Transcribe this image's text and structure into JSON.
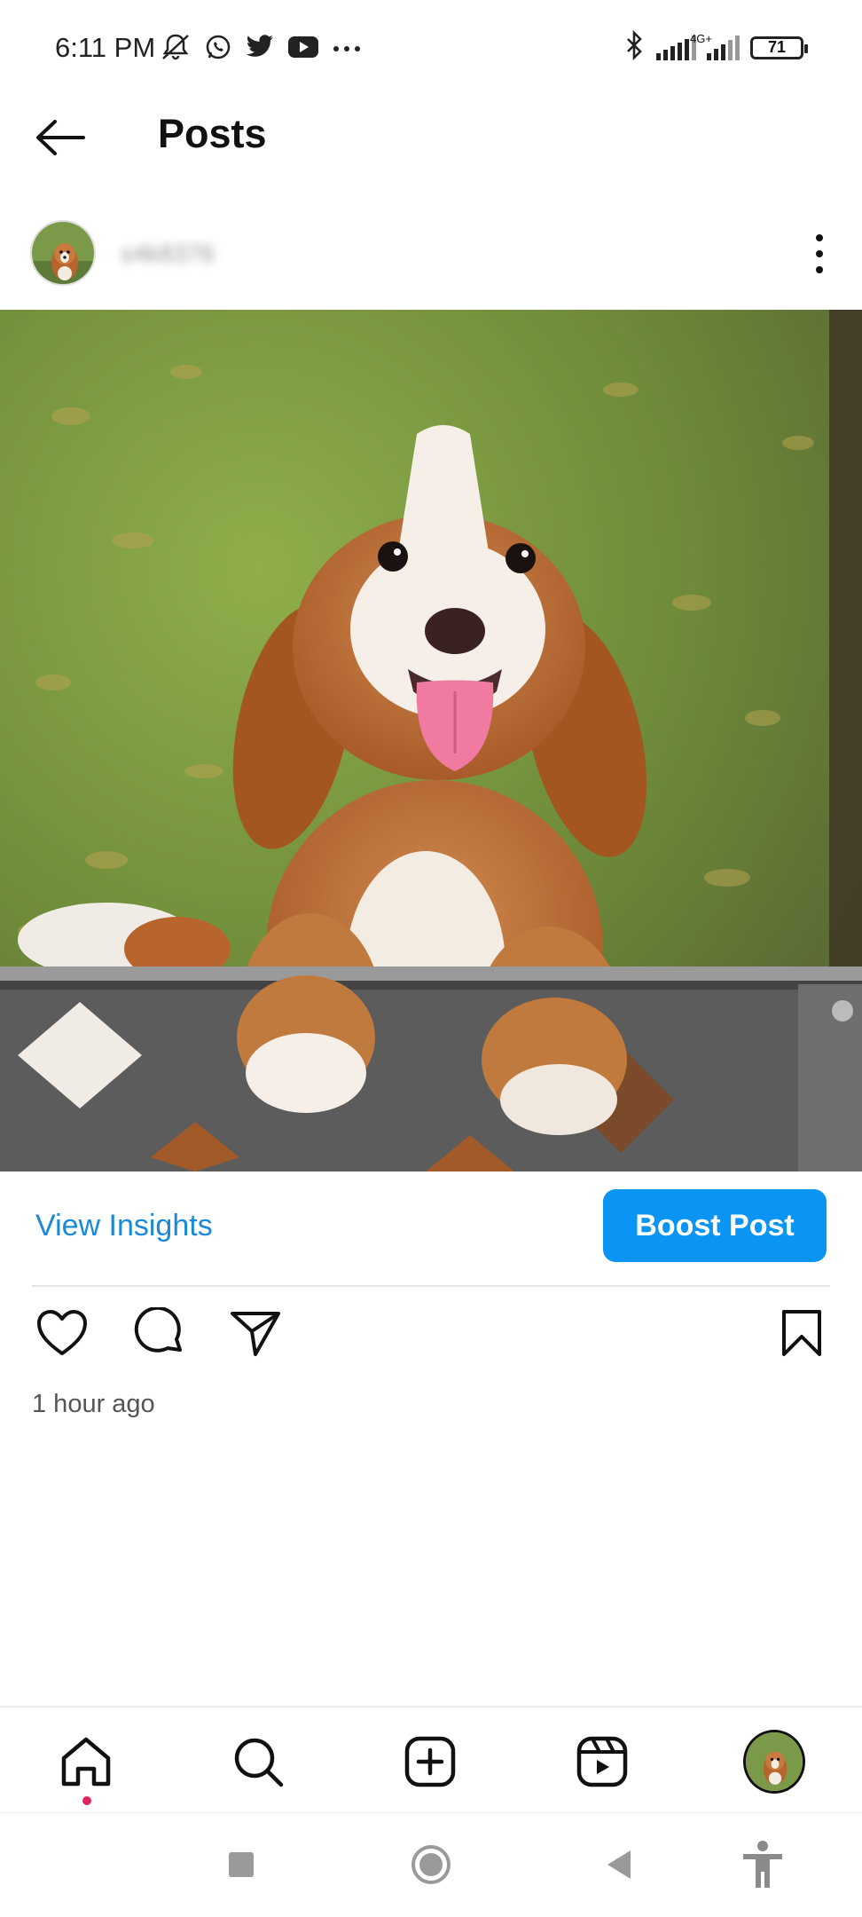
{
  "status_bar": {
    "time": "6:11 PM",
    "network_label": "4G+",
    "battery": "71",
    "icons": [
      "mute-icon",
      "whatsapp-icon",
      "twitter-icon",
      "youtube-icon",
      "more-icon",
      "bluetooth-icon",
      "signal-icon",
      "signal-icon"
    ]
  },
  "header": {
    "title": "Posts",
    "back_icon": "arrow-left-icon"
  },
  "post": {
    "username": "s4k8376",
    "avatar": "dog-avatar",
    "image": "puppy-photo",
    "timestamp": "1 hour ago"
  },
  "insights": {
    "view_label": "View Insights",
    "boost_label": "Boost Post"
  },
  "actions": [
    "heart-icon",
    "comment-icon",
    "share-icon",
    "bookmark-icon"
  ],
  "bottom_nav": {
    "items": [
      "home-icon",
      "search-icon",
      "create-icon",
      "reels-icon",
      "profile-avatar"
    ],
    "active": "home-icon"
  },
  "system_nav": [
    "recents-icon",
    "home-circle-icon",
    "back-triangle-icon",
    "accessibility-icon"
  ],
  "colors": {
    "accent_blue": "#0a95f5",
    "link_blue": "#1a8ad8",
    "notification_red": "#e0245e"
  }
}
